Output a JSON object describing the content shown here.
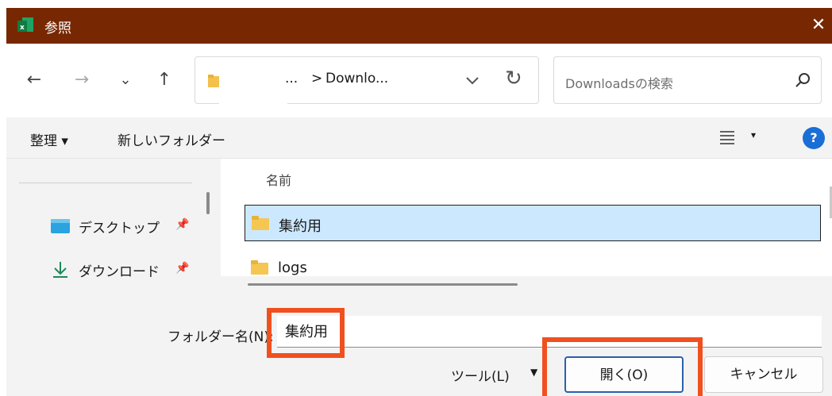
{
  "window": {
    "title": "参照",
    "close_glyph": "✕"
  },
  "nav": {
    "back": "←",
    "forward": "→",
    "recent": "⌄",
    "up": "↑"
  },
  "address": {
    "ellipsis": "...",
    "separator": ">",
    "current": "Downlo...",
    "refresh": "↻"
  },
  "search": {
    "placeholder": "Downloadsの検索"
  },
  "commandbar": {
    "organize": "整理 ▾",
    "new_folder": "新しいフォルダー",
    "view_caret": "▾",
    "help": "?"
  },
  "sidebar": {
    "items": [
      {
        "label": "デスクトップ",
        "icon": "desktop-icon",
        "pinned": true
      },
      {
        "label": "ダウンロード",
        "icon": "download-icon",
        "pinned": true
      }
    ],
    "pin_glyph": "📌"
  },
  "filelist": {
    "column_name": "名前",
    "rows": [
      {
        "name": "集約用",
        "selected": true
      },
      {
        "name": "logs",
        "selected": false
      }
    ]
  },
  "bottom": {
    "folder_name_label": "フォルダー名(N):",
    "folder_name_value": "集約用",
    "tools_label": "ツール(L)",
    "tools_caret": "▼",
    "open_button": "開く(O)",
    "cancel_button": "キャンセル"
  },
  "colors": {
    "titlebar": "#772803",
    "highlight": "#f0501f",
    "selection": "#cce8ff",
    "accent": "#1a6fd6"
  }
}
